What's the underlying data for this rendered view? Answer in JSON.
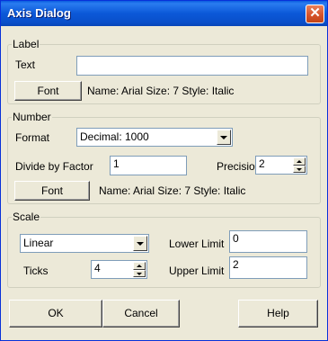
{
  "window": {
    "title": "Axis Dialog",
    "close_glyph": "✕"
  },
  "label_group": {
    "legend": "Label",
    "text_label": "Text",
    "text_value": "",
    "font_button": "Font",
    "font_info": "Name: Arial Size: 7 Style: Italic"
  },
  "number_group": {
    "legend": "Number",
    "format_label": "Format",
    "format_value": "Decimal:  1000",
    "divide_label": "Divide by Factor",
    "divide_value": "1",
    "precision_label": "Precision",
    "precision_value": "2",
    "font_button": "Font",
    "font_info": "Name: Arial Size: 7 Style: Italic"
  },
  "scale_group": {
    "legend": "Scale",
    "scale_type_value": "Linear",
    "lower_limit_label": "Lower Limit",
    "lower_limit_value": "0",
    "ticks_label": "Ticks",
    "ticks_value": "4",
    "upper_limit_label": "Upper Limit",
    "upper_limit_value": "2"
  },
  "buttons": {
    "ok": "OK",
    "cancel": "Cancel",
    "help": "Help"
  },
  "colors": {
    "titlebar": "#0a58d8",
    "close": "#d6542c",
    "face": "#ece9d8"
  }
}
